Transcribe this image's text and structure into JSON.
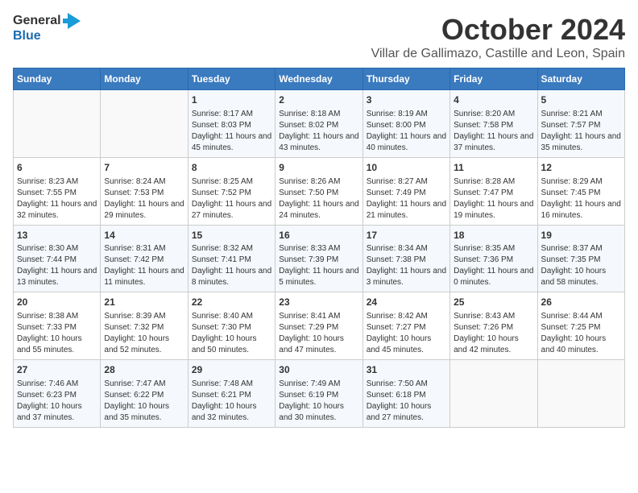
{
  "logo": {
    "line1": "General",
    "line2": "Blue"
  },
  "title": "October 2024",
  "subtitle": "Villar de Gallimazo, Castille and Leon, Spain",
  "days_header": [
    "Sunday",
    "Monday",
    "Tuesday",
    "Wednesday",
    "Thursday",
    "Friday",
    "Saturday"
  ],
  "weeks": [
    [
      {
        "day": "",
        "info": ""
      },
      {
        "day": "",
        "info": ""
      },
      {
        "day": "1",
        "info": "Sunrise: 8:17 AM\nSunset: 8:03 PM\nDaylight: 11 hours and 45 minutes."
      },
      {
        "day": "2",
        "info": "Sunrise: 8:18 AM\nSunset: 8:02 PM\nDaylight: 11 hours and 43 minutes."
      },
      {
        "day": "3",
        "info": "Sunrise: 8:19 AM\nSunset: 8:00 PM\nDaylight: 11 hours and 40 minutes."
      },
      {
        "day": "4",
        "info": "Sunrise: 8:20 AM\nSunset: 7:58 PM\nDaylight: 11 hours and 37 minutes."
      },
      {
        "day": "5",
        "info": "Sunrise: 8:21 AM\nSunset: 7:57 PM\nDaylight: 11 hours and 35 minutes."
      }
    ],
    [
      {
        "day": "6",
        "info": "Sunrise: 8:23 AM\nSunset: 7:55 PM\nDaylight: 11 hours and 32 minutes."
      },
      {
        "day": "7",
        "info": "Sunrise: 8:24 AM\nSunset: 7:53 PM\nDaylight: 11 hours and 29 minutes."
      },
      {
        "day": "8",
        "info": "Sunrise: 8:25 AM\nSunset: 7:52 PM\nDaylight: 11 hours and 27 minutes."
      },
      {
        "day": "9",
        "info": "Sunrise: 8:26 AM\nSunset: 7:50 PM\nDaylight: 11 hours and 24 minutes."
      },
      {
        "day": "10",
        "info": "Sunrise: 8:27 AM\nSunset: 7:49 PM\nDaylight: 11 hours and 21 minutes."
      },
      {
        "day": "11",
        "info": "Sunrise: 8:28 AM\nSunset: 7:47 PM\nDaylight: 11 hours and 19 minutes."
      },
      {
        "day": "12",
        "info": "Sunrise: 8:29 AM\nSunset: 7:45 PM\nDaylight: 11 hours and 16 minutes."
      }
    ],
    [
      {
        "day": "13",
        "info": "Sunrise: 8:30 AM\nSunset: 7:44 PM\nDaylight: 11 hours and 13 minutes."
      },
      {
        "day": "14",
        "info": "Sunrise: 8:31 AM\nSunset: 7:42 PM\nDaylight: 11 hours and 11 minutes."
      },
      {
        "day": "15",
        "info": "Sunrise: 8:32 AM\nSunset: 7:41 PM\nDaylight: 11 hours and 8 minutes."
      },
      {
        "day": "16",
        "info": "Sunrise: 8:33 AM\nSunset: 7:39 PM\nDaylight: 11 hours and 5 minutes."
      },
      {
        "day": "17",
        "info": "Sunrise: 8:34 AM\nSunset: 7:38 PM\nDaylight: 11 hours and 3 minutes."
      },
      {
        "day": "18",
        "info": "Sunrise: 8:35 AM\nSunset: 7:36 PM\nDaylight: 11 hours and 0 minutes."
      },
      {
        "day": "19",
        "info": "Sunrise: 8:37 AM\nSunset: 7:35 PM\nDaylight: 10 hours and 58 minutes."
      }
    ],
    [
      {
        "day": "20",
        "info": "Sunrise: 8:38 AM\nSunset: 7:33 PM\nDaylight: 10 hours and 55 minutes."
      },
      {
        "day": "21",
        "info": "Sunrise: 8:39 AM\nSunset: 7:32 PM\nDaylight: 10 hours and 52 minutes."
      },
      {
        "day": "22",
        "info": "Sunrise: 8:40 AM\nSunset: 7:30 PM\nDaylight: 10 hours and 50 minutes."
      },
      {
        "day": "23",
        "info": "Sunrise: 8:41 AM\nSunset: 7:29 PM\nDaylight: 10 hours and 47 minutes."
      },
      {
        "day": "24",
        "info": "Sunrise: 8:42 AM\nSunset: 7:27 PM\nDaylight: 10 hours and 45 minutes."
      },
      {
        "day": "25",
        "info": "Sunrise: 8:43 AM\nSunset: 7:26 PM\nDaylight: 10 hours and 42 minutes."
      },
      {
        "day": "26",
        "info": "Sunrise: 8:44 AM\nSunset: 7:25 PM\nDaylight: 10 hours and 40 minutes."
      }
    ],
    [
      {
        "day": "27",
        "info": "Sunrise: 7:46 AM\nSunset: 6:23 PM\nDaylight: 10 hours and 37 minutes."
      },
      {
        "day": "28",
        "info": "Sunrise: 7:47 AM\nSunset: 6:22 PM\nDaylight: 10 hours and 35 minutes."
      },
      {
        "day": "29",
        "info": "Sunrise: 7:48 AM\nSunset: 6:21 PM\nDaylight: 10 hours and 32 minutes."
      },
      {
        "day": "30",
        "info": "Sunrise: 7:49 AM\nSunset: 6:19 PM\nDaylight: 10 hours and 30 minutes."
      },
      {
        "day": "31",
        "info": "Sunrise: 7:50 AM\nSunset: 6:18 PM\nDaylight: 10 hours and 27 minutes."
      },
      {
        "day": "",
        "info": ""
      },
      {
        "day": "",
        "info": ""
      }
    ]
  ]
}
